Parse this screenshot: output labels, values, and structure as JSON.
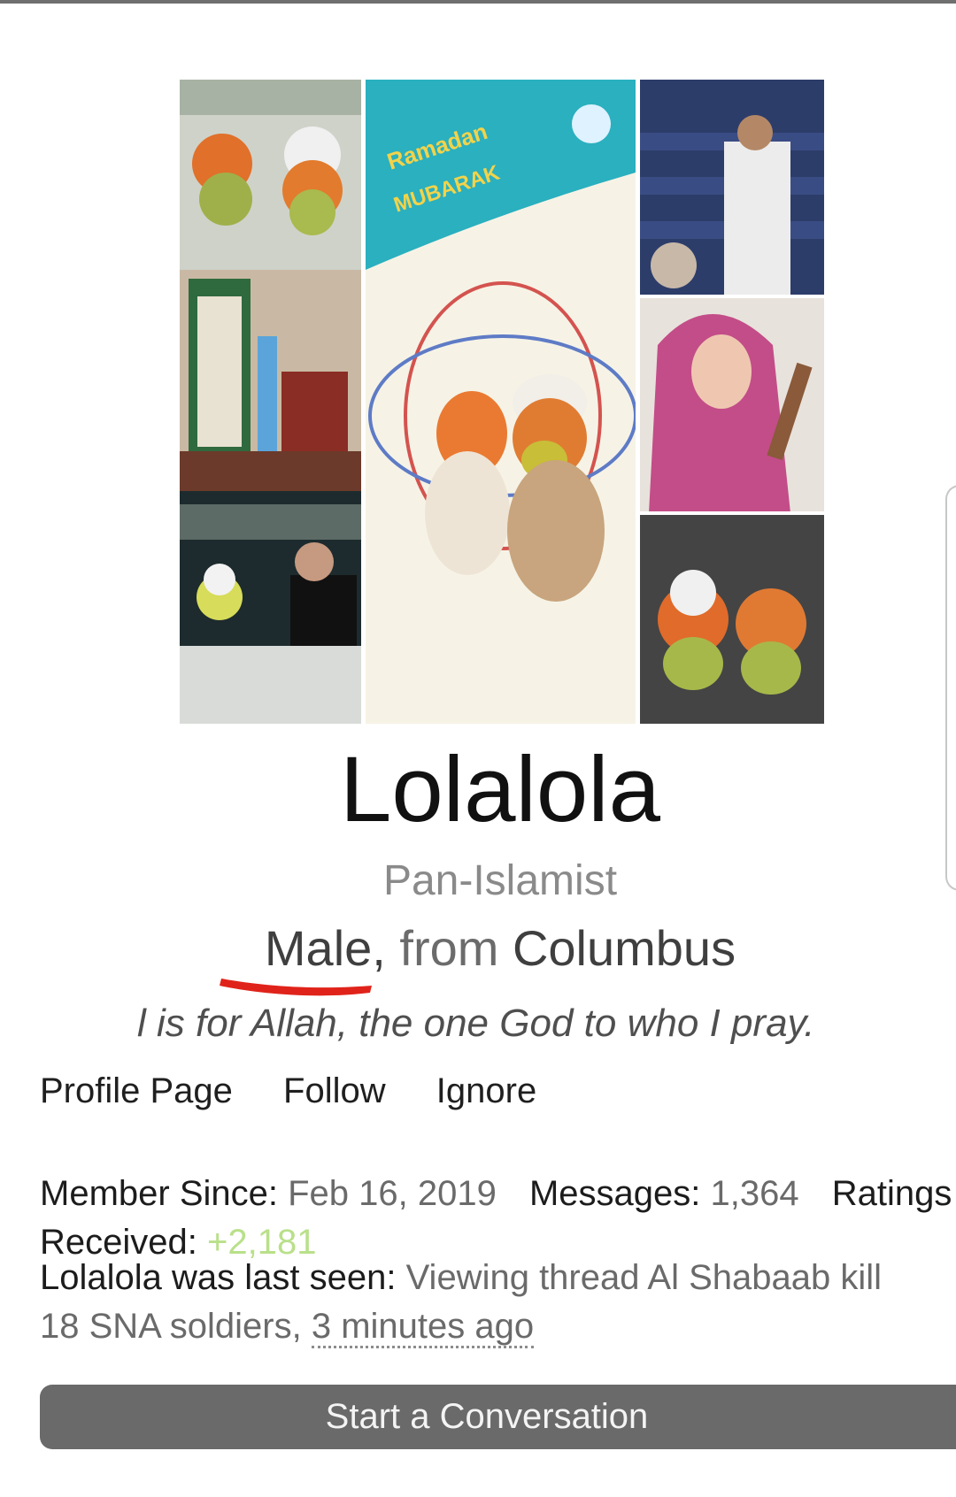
{
  "profile": {
    "username": "Lolalola",
    "user_title": "Pan-Islamist",
    "gender": "Male,",
    "from_word": "from",
    "location": "Columbus",
    "signature": "l is for Allah, the one God to who I pray."
  },
  "avatar": {
    "banner_line1": "Ramadan",
    "banner_line2": "MUBARAK"
  },
  "links": {
    "profile_page": "Profile Page",
    "follow": "Follow",
    "ignore": "Ignore"
  },
  "stats": {
    "member_since_label": "Member Since:",
    "member_since_value": "Feb 16, 2019",
    "messages_label": "Messages:",
    "messages_value": "1,364",
    "ratings_label": "Ratings Received:",
    "ratings_value": "+2,181"
  },
  "last_seen": {
    "label": "Lolalola was last seen:",
    "activity": "Viewing thread Al Shabaab kill 18 SNA soldiers,",
    "time": "3 minutes ago"
  },
  "actions": {
    "start_conversation": "Start a Conversation"
  },
  "colors": {
    "positive_rating": "#b9e08a",
    "button_bg": "#6a6a6a",
    "underline_mark": "#e0231a"
  }
}
